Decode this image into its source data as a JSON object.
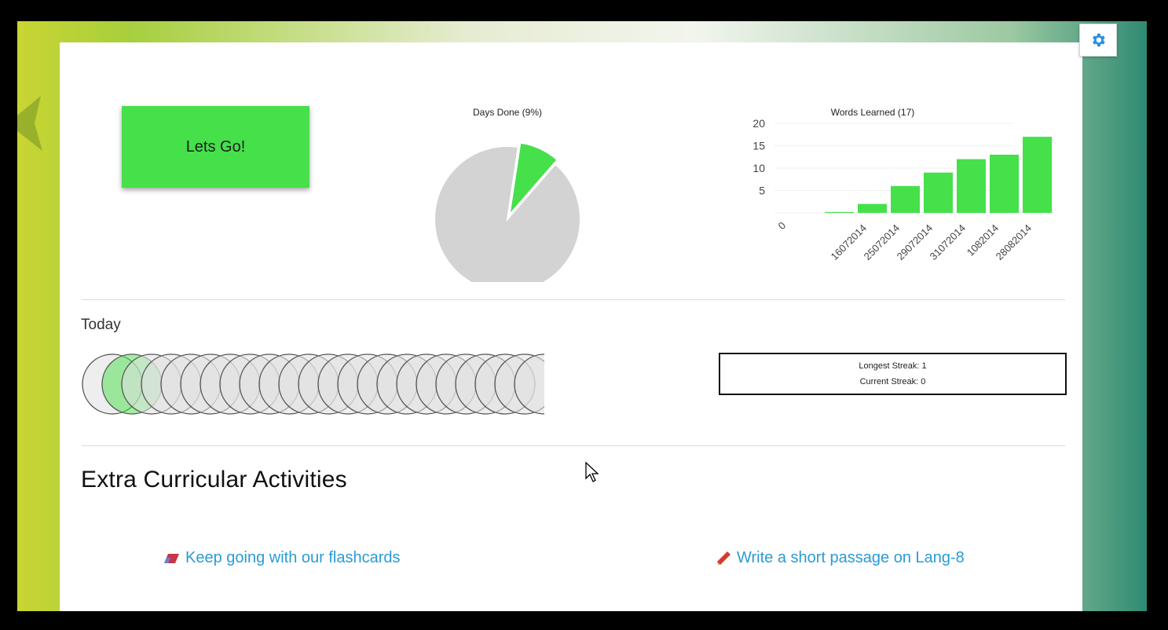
{
  "settings": {
    "icon": "gear-icon"
  },
  "lets_go_label": "Lets Go!",
  "days_chart": {
    "title": "Days Done (9%)",
    "done_fraction": 0.09,
    "done_color": "#45e04a",
    "remaining_color": "#d3d3d3"
  },
  "chart_data": {
    "type": "bar",
    "title": "Words Learned (17)",
    "categories": [
      "16072014",
      "25072014",
      "29072014",
      "31072014",
      "1082014",
      "28082014"
    ],
    "values": [
      0.2,
      2,
      6,
      9,
      12,
      13,
      17
    ],
    "all_categories": [
      "",
      "16072014",
      "25072014",
      "29072014",
      "31072014",
      "1082014",
      "28082014"
    ],
    "yticks": [
      0,
      5,
      10,
      15,
      20
    ],
    "ylim": [
      0,
      20
    ],
    "color": "#45e04a"
  },
  "today": {
    "label": "Today",
    "total_circles": 23,
    "completed_circles": 1,
    "done_color": "#45e04a"
  },
  "streak": {
    "longest": "Longest Streak: 1",
    "current": "Current Streak: 0"
  },
  "extra": {
    "title": "Extra Curricular Activities",
    "links": [
      {
        "label": "Keep going with our flashcards",
        "icon": "eraser-icon"
      },
      {
        "label": "Write a short passage on Lang-8",
        "icon": "pencil-icon"
      }
    ]
  }
}
